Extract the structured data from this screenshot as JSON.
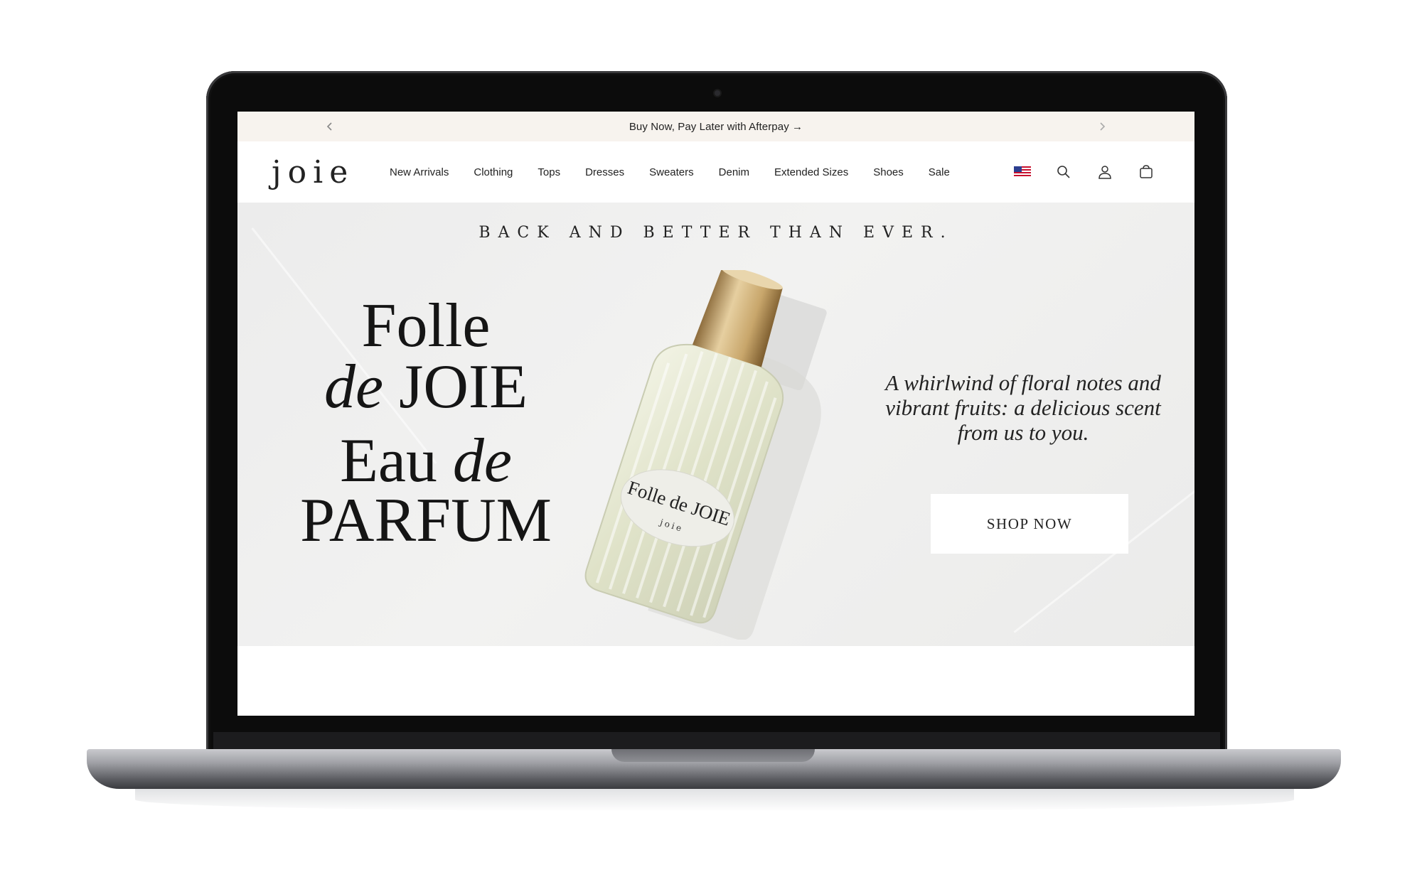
{
  "announcement": {
    "text": "Buy Now, Pay Later with Afterpay →",
    "prev_icon": "chevron-left-icon",
    "next_icon": "chevron-right-icon"
  },
  "header": {
    "logo": "joie",
    "menu": [
      {
        "label": "New Arrivals"
      },
      {
        "label": "Clothing"
      },
      {
        "label": "Tops"
      },
      {
        "label": "Dresses"
      },
      {
        "label": "Sweaters"
      },
      {
        "label": "Denim"
      },
      {
        "label": "Extended Sizes"
      },
      {
        "label": "Shoes"
      },
      {
        "label": "Sale"
      }
    ],
    "utility_icons": [
      "us-flag-icon",
      "search-icon",
      "account-icon",
      "cart-icon"
    ]
  },
  "hero": {
    "tagline": "BACK AND BETTER THAN EVER.",
    "headline": {
      "line1": "Folle",
      "line2_italic": "de",
      "line2_rest": " JOIE",
      "line3_rest": "Eau ",
      "line3_italic": "de",
      "line4": "PARFUM"
    },
    "bottle_label": {
      "line1": "Folle de JOIE",
      "line2": "joie"
    },
    "description": "A whirlwind of floral notes and vibrant fruits: a delicious scent from us to you.",
    "cta_label": "SHOP NOW"
  },
  "colors": {
    "announcement_bg": "#f7f3ee",
    "hero_bg": "#eeeeed",
    "text": "#222222",
    "cap_gold": "#c8a66b",
    "laptop_bezel": "#0c0c0c"
  }
}
